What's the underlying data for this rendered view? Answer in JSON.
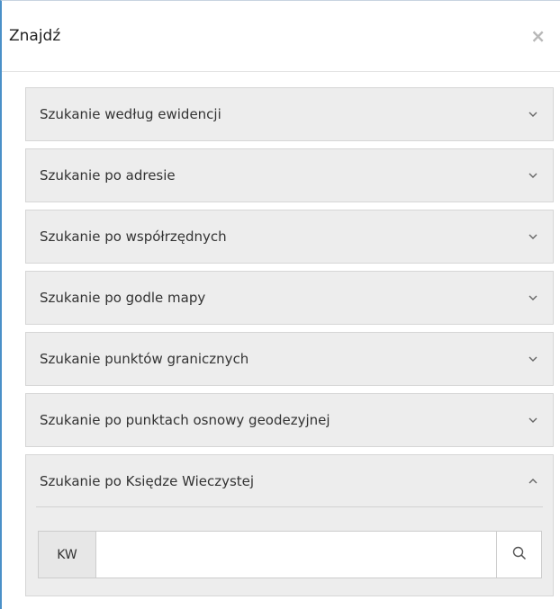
{
  "header": {
    "title": "Znajdź",
    "close_label": "×"
  },
  "sections": [
    {
      "label": "Szukanie według ewidencji",
      "icon": "chevron-down-icon"
    },
    {
      "label": "Szukanie po adresie",
      "icon": "chevron-down-icon"
    },
    {
      "label": "Szukanie po współrzędnych",
      "icon": "chevron-down-icon"
    },
    {
      "label": "Szukanie po godle mapy",
      "icon": "chevron-down-icon"
    },
    {
      "label": "Szukanie punktów granicznych",
      "icon": "chevron-down-icon"
    },
    {
      "label": "Szukanie po punktach osnowy geodezyjnej",
      "icon": "chevron-down-icon"
    }
  ],
  "expanded_section": {
    "label": "Szukanie po Księdze Wieczystej",
    "icon": "chevron-up-icon",
    "kw_prefix": "KW",
    "kw_value": "",
    "kw_placeholder": "",
    "search_icon": "search-icon"
  },
  "colors": {
    "accent_border": "#4a90c8",
    "section_bg": "#ededed",
    "chevron": "#666666"
  }
}
